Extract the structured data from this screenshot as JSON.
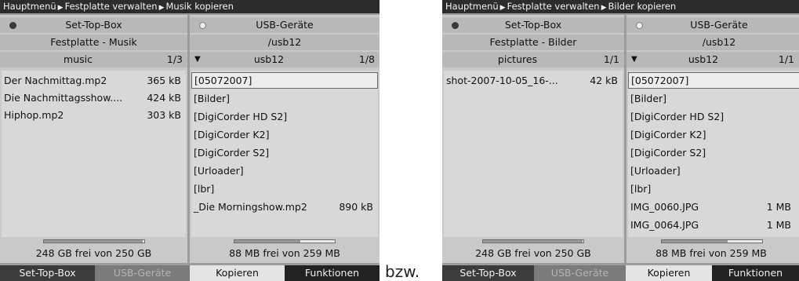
{
  "separator": "bzw.",
  "screen1": {
    "breadcrumb": [
      "Hauptmenü",
      "Festplatte verwalten",
      "Musik kopieren"
    ],
    "left": {
      "device": "Set-Top-Box",
      "subtitle": "Festplatte - Musik",
      "folder": "music",
      "page": "1/3",
      "items": [
        {
          "name": "Der Nachmittag.mp2",
          "size": "365 kB"
        },
        {
          "name": "Die Nachmittagsshow....",
          "size": "424 kB"
        },
        {
          "name": "Hiphop.mp2",
          "size": "303 kB"
        }
      ],
      "free": "248 GB frei von 250 GB",
      "usage_fraction": 0.99
    },
    "right": {
      "device": "USB-Geräte",
      "subtitle": "/usb12",
      "folder": "usb12",
      "page": "1/8",
      "items": [
        {
          "name": "[05072007]",
          "size": ""
        },
        {
          "name": "[Bilder]",
          "size": ""
        },
        {
          "name": "[DigiCorder HD S2]",
          "size": ""
        },
        {
          "name": "[DigiCorder K2]",
          "size": ""
        },
        {
          "name": "[DigiCorder S2]",
          "size": ""
        },
        {
          "name": "[Urloader]",
          "size": ""
        },
        {
          "name": "[lbr]",
          "size": ""
        },
        {
          "name": "_Die Morningshow.mp2",
          "size": "890 kB"
        }
      ],
      "free": "88 MB frei von 259 MB",
      "usage_fraction": 0.66
    },
    "buttons": [
      "Set-Top-Box",
      "USB-Geräte",
      "Kopieren",
      "Funktionen"
    ]
  },
  "screen2": {
    "breadcrumb": [
      "Hauptmenü",
      "Festplatte verwalten",
      "Bilder kopieren"
    ],
    "left": {
      "device": "Set-Top-Box",
      "subtitle": "Festplatte - Bilder",
      "folder": "pictures",
      "page": "1/1",
      "items": [
        {
          "name": "shot-2007-10-05_16-...",
          "size": "42 kB"
        }
      ],
      "free": "248 GB frei von 250 GB",
      "usage_fraction": 0.99
    },
    "right": {
      "device": "USB-Geräte",
      "subtitle": "/usb12",
      "folder": "usb12",
      "page": "1/1",
      "items": [
        {
          "name": "[05072007]",
          "size": ""
        },
        {
          "name": "[Bilder]",
          "size": ""
        },
        {
          "name": "[DigiCorder HD S2]",
          "size": ""
        },
        {
          "name": "[DigiCorder K2]",
          "size": ""
        },
        {
          "name": "[DigiCorder S2]",
          "size": ""
        },
        {
          "name": "[Urloader]",
          "size": ""
        },
        {
          "name": "[lbr]",
          "size": ""
        },
        {
          "name": "IMG_0060.JPG",
          "size": "1 MB"
        },
        {
          "name": "IMG_0064.JPG",
          "size": "1 MB"
        }
      ],
      "free": "88 MB frei von 259 MB",
      "usage_fraction": 0.66
    },
    "buttons": [
      "Set-Top-Box",
      "USB-Geräte",
      "Kopieren",
      "Funktionen"
    ]
  }
}
